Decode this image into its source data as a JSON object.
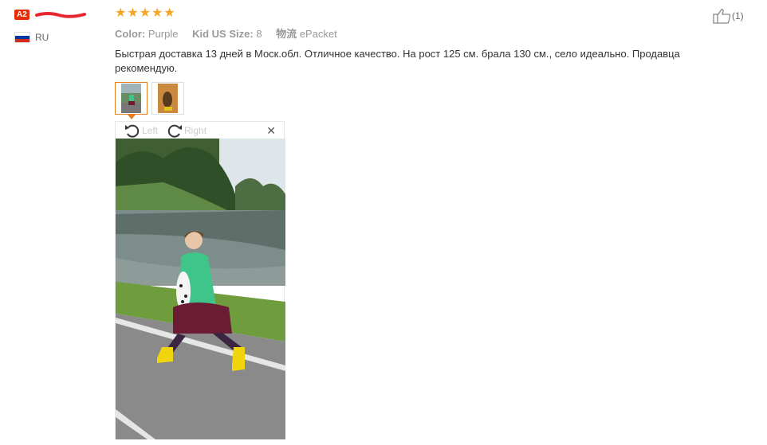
{
  "user": {
    "level_badge": "A2",
    "country": "RU"
  },
  "review": {
    "stars": "★★★★★",
    "color_key": "Color:",
    "color_value": "Purple",
    "size_key": "Kid US Size:",
    "size_value": "8",
    "shipping_key": "物流",
    "shipping_value": "ePacket",
    "text": "Быстрая доставка 13 дней в Моск.обл. Отличное качество. На рост 125 см. брала 130 см., село идеально. Продавца рекомендую."
  },
  "viewer": {
    "rotate_left_label": "Left",
    "rotate_right_label": "Right",
    "close_symbol": "✕"
  },
  "helpful": {
    "count": "(1)"
  },
  "icons": [
    "thumbs-up-icon",
    "rotate-left-icon",
    "rotate-right-icon",
    "close-icon",
    "flag-ru-icon"
  ],
  "colors": {
    "stars": "#f5a623",
    "badge": "#e62e04",
    "active_thumb": "#e67e22"
  }
}
